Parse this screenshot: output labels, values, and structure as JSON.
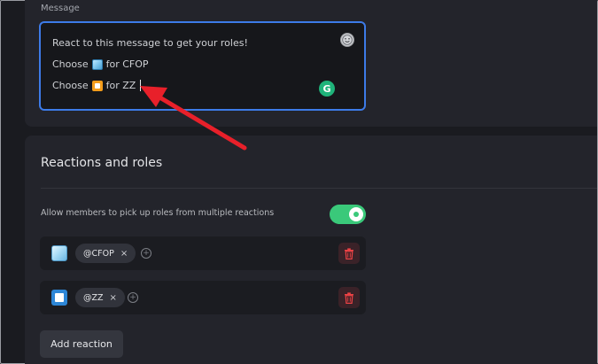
{
  "message_section": {
    "label": "Message",
    "lines": [
      "React to this message to get your roles!",
      {
        "prefix": "Choose",
        "emoji": "ice-cube-emoji",
        "suffix": "for CFOP"
      },
      {
        "prefix": "Choose",
        "emoji": "orange-square-emoji",
        "suffix": "for ZZ"
      }
    ],
    "line1": "React to this message to get your roles!",
    "line2_prefix": "Choose",
    "line2_suffix": "for CFOP",
    "line3_prefix": "Choose",
    "line3_suffix": "for ZZ",
    "emoji_button_icon": "emoji-picker-icon",
    "grammarly_icon": "grammarly-icon",
    "grammarly_letter": "G"
  },
  "reactions_section": {
    "title": "Reactions and roles",
    "toggle_label": "Allow members to pick up roles from multiple reactions",
    "toggle_on": true,
    "toggle_color": "#3ac97a",
    "reactions": [
      {
        "emoji": "ice-cube-emoji",
        "role": "@CFOP"
      },
      {
        "emoji": "white-square-emoji",
        "role": "@ZZ"
      }
    ],
    "role_1": "@CFOP",
    "role_2": "@ZZ",
    "chip_remove": "×",
    "add_role_symbol": "+",
    "delete_color": "#ed4245",
    "add_reaction_label": "Add reaction"
  },
  "annotation": {
    "arrow_color": "#e8202a"
  },
  "colors": {
    "accent_border": "#3d7be8",
    "panel": "#23242b",
    "background": "#1a1b20"
  }
}
